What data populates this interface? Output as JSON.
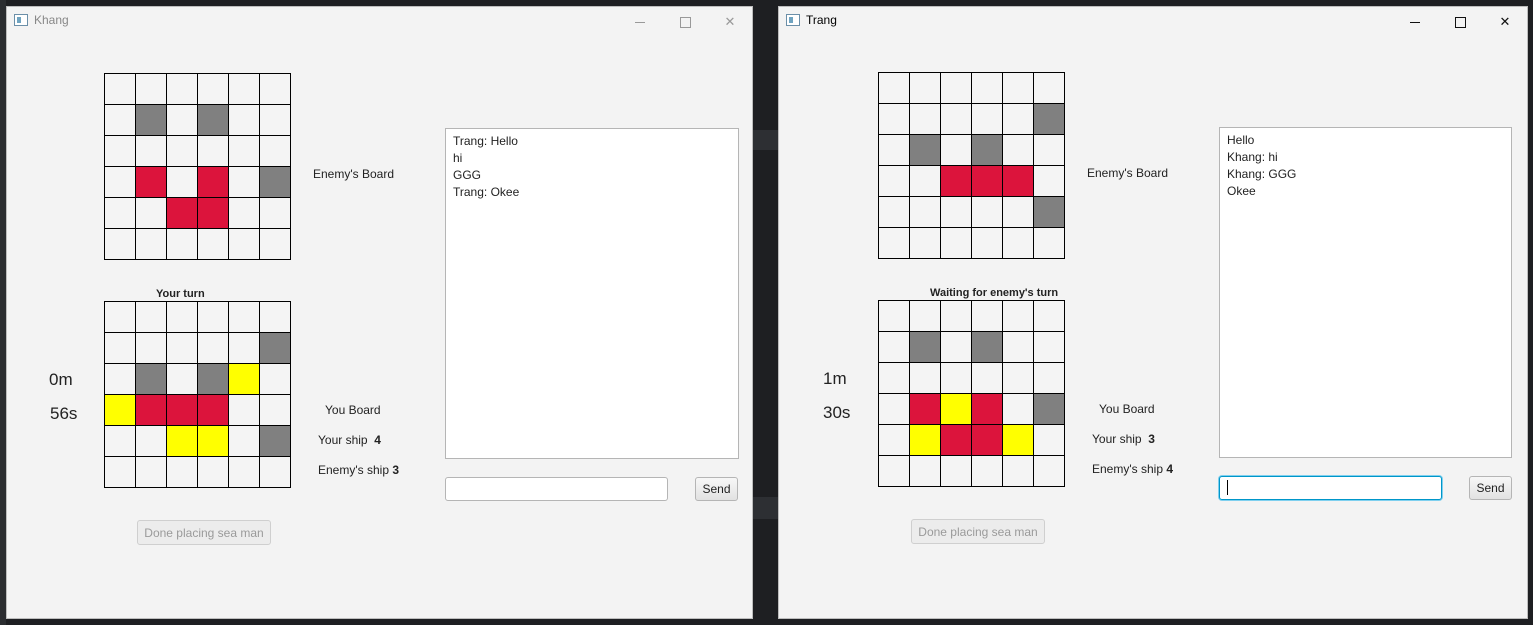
{
  "windows": [
    {
      "title": "Khang",
      "enemy_board_label": "Enemy's Board",
      "turn_label": "Your turn",
      "timer_minutes": "0m",
      "timer_seconds": "56s",
      "you_board_label": "You Board",
      "your_ship_label": "Your ship",
      "your_ship_count": "4",
      "enemy_ship_label": "Enemy's ship",
      "enemy_ship_count": "3",
      "done_button": "Done placing sea man",
      "send_button": "Send",
      "chat_input_value": "",
      "chat_messages": [
        "Trang: Hello",
        "hi",
        "GGG",
        "Trang: Okee"
      ],
      "enemy_board": [
        [
          0,
          0,
          0,
          0,
          0,
          0
        ],
        [
          0,
          1,
          0,
          1,
          0,
          0
        ],
        [
          0,
          0,
          0,
          0,
          0,
          0
        ],
        [
          0,
          2,
          0,
          2,
          0,
          1
        ],
        [
          0,
          0,
          2,
          2,
          0,
          0
        ],
        [
          0,
          0,
          0,
          0,
          0,
          0
        ]
      ],
      "own_board": [
        [
          0,
          0,
          0,
          0,
          0,
          0
        ],
        [
          0,
          0,
          0,
          0,
          0,
          1
        ],
        [
          0,
          1,
          0,
          1,
          3,
          0
        ],
        [
          3,
          2,
          2,
          2,
          0,
          0
        ],
        [
          0,
          0,
          3,
          3,
          0,
          1
        ],
        [
          0,
          0,
          0,
          0,
          0,
          0
        ]
      ]
    },
    {
      "title": "Trang",
      "enemy_board_label": "Enemy's Board",
      "turn_label": "Waiting for enemy's turn",
      "timer_minutes": "1m",
      "timer_seconds": "30s",
      "you_board_label": "You Board",
      "your_ship_label": "Your ship",
      "your_ship_count": "3",
      "enemy_ship_label": "Enemy's ship",
      "enemy_ship_count": "4",
      "done_button": "Done placing sea man",
      "send_button": "Send",
      "chat_input_value": "",
      "chat_messages": [
        "Hello",
        "Khang: hi",
        "Khang: GGG",
        "Okee"
      ],
      "enemy_board": [
        [
          0,
          0,
          0,
          0,
          0,
          0
        ],
        [
          0,
          0,
          0,
          0,
          0,
          1
        ],
        [
          0,
          1,
          0,
          1,
          0,
          0
        ],
        [
          0,
          0,
          2,
          2,
          2,
          0
        ],
        [
          0,
          0,
          0,
          0,
          0,
          1
        ],
        [
          0,
          0,
          0,
          0,
          0,
          0
        ]
      ],
      "own_board": [
        [
          0,
          0,
          0,
          0,
          0,
          0
        ],
        [
          0,
          1,
          0,
          1,
          0,
          0
        ],
        [
          0,
          0,
          0,
          0,
          0,
          0
        ],
        [
          0,
          2,
          3,
          2,
          0,
          1
        ],
        [
          0,
          3,
          2,
          2,
          3,
          0
        ],
        [
          0,
          0,
          0,
          0,
          0,
          0
        ]
      ]
    }
  ],
  "cell_legend": {
    "0": "empty",
    "1": "ship",
    "2": "hit",
    "3": "miss"
  },
  "colors": {
    "empty": "#f4f4f4",
    "ship": "#808080",
    "hit": "#dc143c",
    "miss": "#ffff00"
  },
  "window_controls": {
    "minimize": "minimize-icon",
    "maximize": "maximize-icon",
    "close": "close-icon"
  }
}
